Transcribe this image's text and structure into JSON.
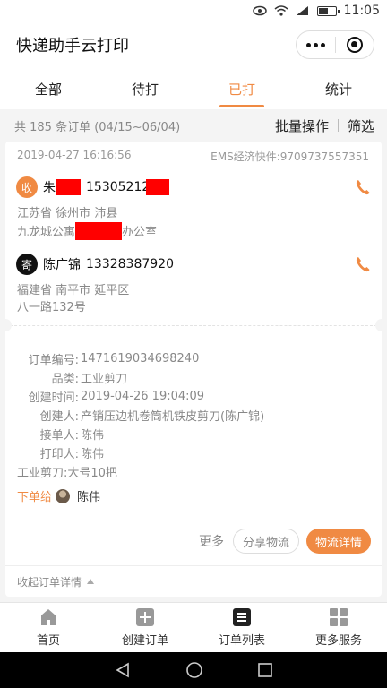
{
  "status_bar": {
    "time": "11:05",
    "battery_level": 0.6
  },
  "title_bar": {
    "title": "快递助手云打印"
  },
  "tabs": [
    {
      "label": "全部",
      "active": false
    },
    {
      "label": "待打",
      "active": false
    },
    {
      "label": "已打",
      "active": true
    },
    {
      "label": "统计",
      "active": false
    }
  ],
  "summary": {
    "text": "共 185 条订单 (04/15~06/04)",
    "batch_label": "批量操作",
    "filter_label": "筛选"
  },
  "order": {
    "created_at": "2019-04-27 16:16:56",
    "courier": "EMS经济快件:9709737557351",
    "receiver": {
      "badge": "收",
      "name_visible": "朱",
      "phone_visible": "15305212",
      "province_city": "江苏省 徐州市 沛县",
      "addr_prefix": "九龙城公寓",
      "addr_suffix": "办公室"
    },
    "sender": {
      "badge": "寄",
      "name": "陈广锦",
      "phone": "13328387920",
      "province_city": "福建省 南平市 延平区",
      "addr": "八一路132号"
    },
    "details": {
      "order_no_label": "订单编号:",
      "order_no": "1471619034698240",
      "category_label": "品类:",
      "category": "工业剪刀",
      "created_label": "创建时间:",
      "created": "2019-04-26 19:04:09",
      "creator_label": "创建人:",
      "creator": "产销压边机卷筒机铁皮剪刀(陈广锦)",
      "acceptor_label": "接单人:",
      "acceptor": "陈伟",
      "printer_label": "打印人:",
      "printer": "陈伟",
      "goods": "工业剪刀:大号10把"
    },
    "assign_label": "下单给",
    "assign_name": "陈伟",
    "more_label": "更多",
    "share_label": "分享物流",
    "logistics_label": "物流详情",
    "collapse_label": "收起订单详情"
  },
  "tab_bar": [
    {
      "label": "首页",
      "icon": "home-icon"
    },
    {
      "label": "创建订单",
      "icon": "add-order-icon"
    },
    {
      "label": "订单列表",
      "icon": "order-list-icon",
      "active": true
    },
    {
      "label": "更多服务",
      "icon": "grid-icon"
    }
  ],
  "colors": {
    "accent": "#f08a43",
    "redaction": "#ff0000"
  }
}
